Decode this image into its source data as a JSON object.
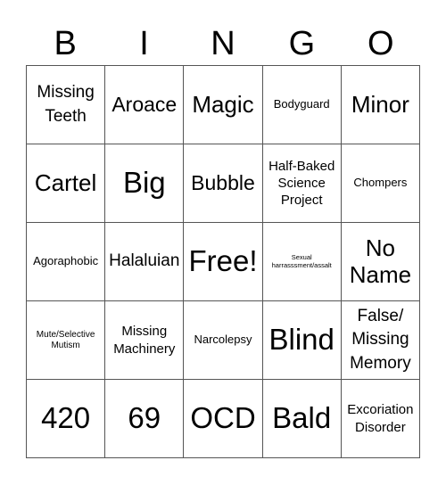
{
  "header": {
    "letters": [
      "B",
      "I",
      "N",
      "G",
      "O"
    ]
  },
  "cells": [
    [
      "Missing Teeth",
      "Aroace",
      "Magic",
      "Bodyguard",
      "Minor"
    ],
    [
      "Cartel",
      "Big",
      "Bubble",
      "Half-Baked Science Project",
      "Chompers"
    ],
    [
      "Agoraphobic",
      "Halaluian",
      "Free!",
      "Sexual harrasssment/assalt",
      "No Name"
    ],
    [
      "Mute/Selective Mutism",
      "Missing Machinery",
      "Narcolepsy",
      "Blind",
      "False/ Missing Memory"
    ],
    [
      "420",
      "69",
      "OCD",
      "Bald",
      "Excoriation Disorder"
    ]
  ]
}
